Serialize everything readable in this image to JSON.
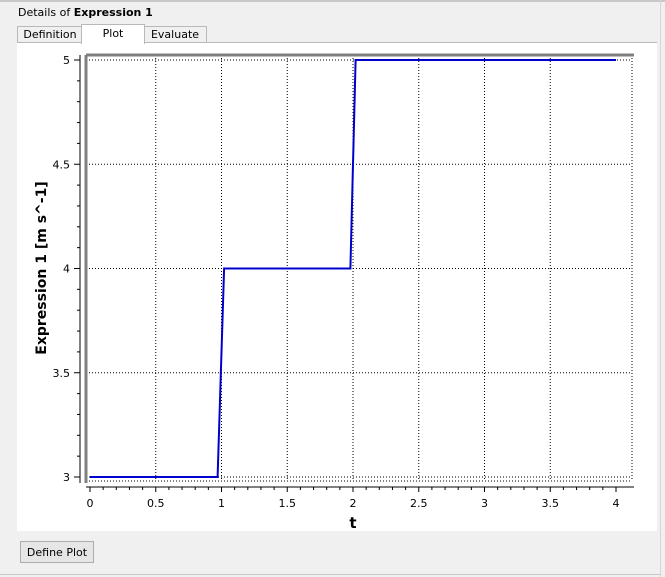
{
  "header": {
    "prefix": "Details of ",
    "name": "Expression 1"
  },
  "tabs": [
    {
      "label": "Definition",
      "active": false
    },
    {
      "label": "Plot",
      "active": true
    },
    {
      "label": "Evaluate",
      "active": false
    }
  ],
  "footer": {
    "define_plot_label": "Define Plot"
  },
  "chart_data": {
    "type": "line",
    "title": "",
    "xlabel": "t",
    "ylabel": "Expression 1 [m s^-1]",
    "xlim": [
      0,
      4
    ],
    "ylim": [
      3,
      5
    ],
    "xticks": [
      "0",
      "0.5",
      "1",
      "1.5",
      "2",
      "2.5",
      "3",
      "3.5",
      "4"
    ],
    "yticks": [
      "3",
      "3.5",
      "4",
      "4.5",
      "5"
    ],
    "grid": true,
    "line_color": "#0000cc",
    "series": [
      {
        "x": [
          0,
          0.97,
          1.02,
          1.98,
          2.02,
          4
        ],
        "y": [
          3,
          3,
          4,
          4,
          5,
          5
        ]
      }
    ]
  }
}
